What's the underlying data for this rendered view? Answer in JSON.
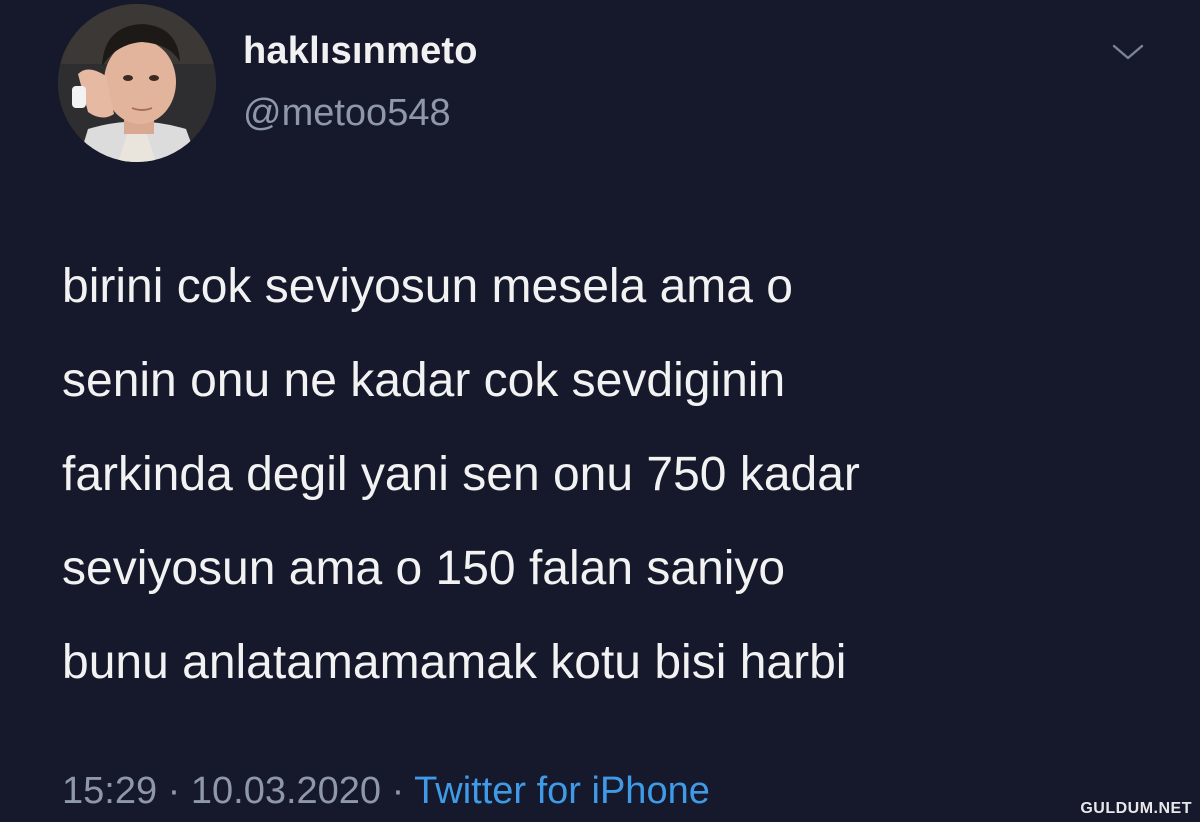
{
  "user": {
    "display_name": "haklısınmeto",
    "handle": "@metoo548"
  },
  "tweet": {
    "lines": [
      "birini cok seviyosun mesela ama o",
      "senin onu ne kadar cok sevdiginin",
      "farkinda degil yani sen onu 750 kadar",
      "seviyosun ama o 150 falan saniyo",
      "bunu anlatamamamak kotu bisi harbi"
    ],
    "time": "15:29",
    "date": "10.03.2020",
    "separator": "·",
    "source": "Twitter for iPhone"
  },
  "icons": {
    "more": "chevron-down-icon",
    "avatar": "profile-photo"
  },
  "colors": {
    "background": "#15192b",
    "text": "#f2f2f2",
    "muted": "#8f98a8",
    "link": "#3f9be8"
  },
  "watermark": "GULDUM.NET"
}
